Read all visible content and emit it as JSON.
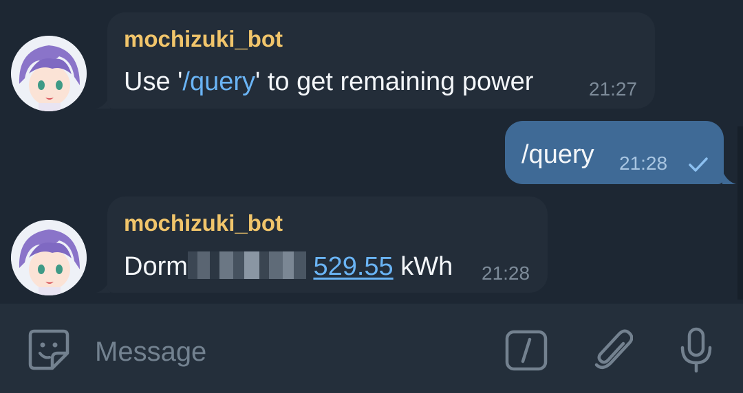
{
  "messages": [
    {
      "sender": "mochizuki_bot",
      "text_before": "Use '",
      "command": "/query",
      "text_after": "' to get remaining power",
      "time": "21:27"
    },
    {
      "text": "/query",
      "time": "21:28",
      "status": "sent-check-icon"
    },
    {
      "sender": "mochizuki_bot",
      "text_prefix": "Dorm",
      "value": "529.55",
      "unit": "kWh",
      "time": "21:28"
    }
  ],
  "composer": {
    "placeholder": "Message",
    "icons": [
      "sticker-icon",
      "bot-command-icon",
      "attach-icon",
      "microphone-icon"
    ]
  },
  "colors": {
    "background": "#1d2733",
    "incoming_bubble": "#232d39",
    "outgoing_bubble": "#3f6a96",
    "sender_name": "#f1c56b",
    "link": "#6ab4f5",
    "composer": "#242f3b"
  }
}
